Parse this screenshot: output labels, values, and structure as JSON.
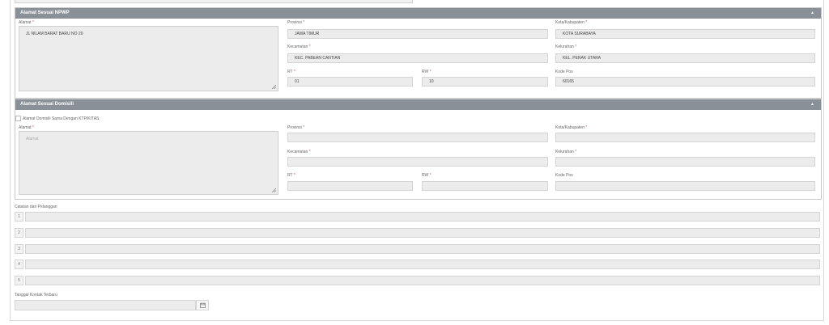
{
  "npwp": {
    "title": "Alamat Sesuai NPWP",
    "caret": "▲",
    "alamat_label": "Alamat",
    "alamat_value": "JL NILAM BARAT BARU NO 20",
    "provinsi_label": "Provinsi",
    "provinsi_value": "JAWA TIMUR",
    "kota_label": "Kota/Kabupaten",
    "kota_value": "KOTA SURABAYA",
    "kecamatan_label": "Kecamatan",
    "kecamatan_value": "KEC. PABEAN CANTIAN",
    "kelurahan_label": "Kelurahan",
    "kelurahan_value": "KEL. PERAK UTARA",
    "rt_label": "RT",
    "rt_value": "01",
    "rw_label": "RW",
    "rw_value": "10",
    "kodepos_label": "Kode Pos",
    "kodepos_value": "60165"
  },
  "domisili": {
    "title": "Alamat Sesuai Domisili",
    "caret": "▲",
    "checkbox_label": "Alamat Domisili Sama Dengan KTP/KITAS",
    "alamat_label": "Alamat",
    "alamat_placeholder": "Alamat",
    "provinsi_label": "Provinsi",
    "kota_label": "Kota/Kabupaten",
    "kecamatan_label": "Kecamatan",
    "kelurahan_label": "Kelurahan",
    "rt_label": "RT",
    "rw_label": "RW",
    "kodepos_label": "Kode Pos"
  },
  "required_mark": "*",
  "notes": {
    "label": "Catatan dari Pelanggan",
    "rows": [
      "1",
      "2",
      "3",
      "4",
      "5"
    ]
  },
  "last_contact": {
    "label": "Tanggal Kontak Terbaru",
    "icon": "calendar-icon"
  }
}
